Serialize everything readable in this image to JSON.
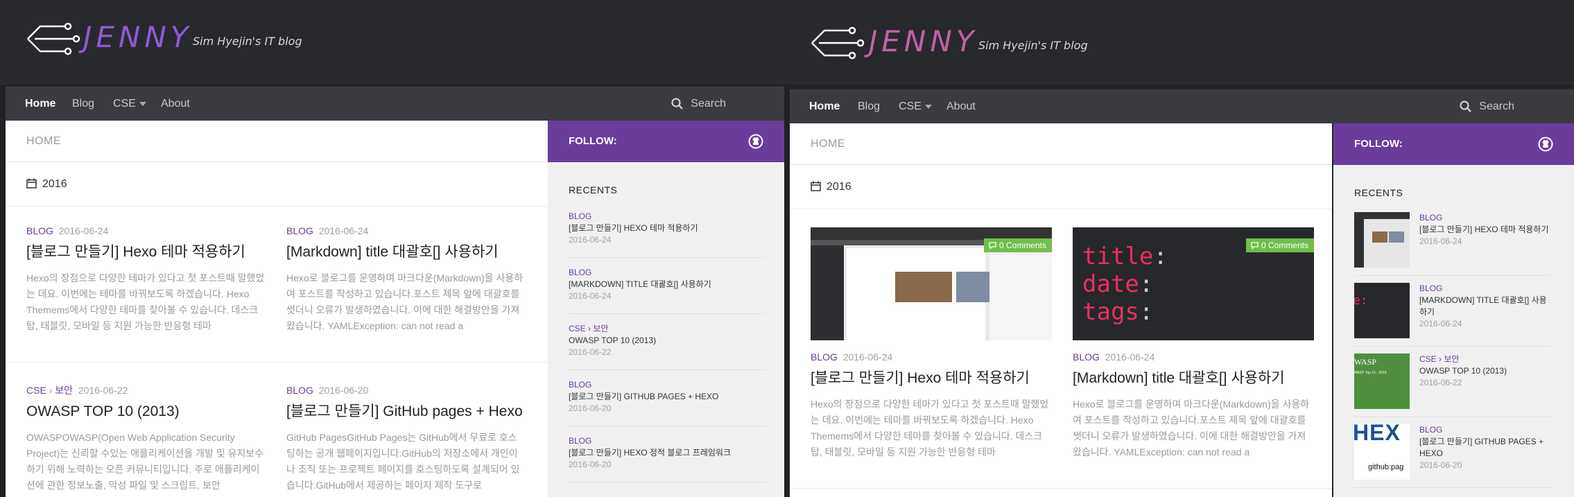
{
  "left": {
    "header": {
      "logo_text": "JENNY",
      "tagline": "Sim Hyejin's IT blog"
    },
    "nav": {
      "items": [
        "Home",
        "Blog",
        "CSE",
        "About"
      ],
      "search": "Search"
    },
    "breadcrumb": "HOME",
    "year": "2016",
    "posts": [
      {
        "category": "BLOG",
        "date": "2016-06-24",
        "title": "[블로그 만들기] Hexo 테마 적용하기",
        "excerpt": "Hexo의 장점으로 다양한 테마가 있다고 첫 포스트때 말했었는 데요. 이번에는 테마를 바꿔보도록 하겠습니다. Hexo Themems에서 다양한 테마를 찾아볼 수 있습니다. 데스크탑, 태블릿, 모바일 등 지원 가능한 반응형 테마"
      },
      {
        "category": "BLOG",
        "date": "2016-06-24",
        "title": "[Markdown] title 대괄호[] 사용하기",
        "excerpt": "Hexo로 블로그를 운영하며 마크다운(Markdown)을 사용하여 포스트를 작성하고 있습니다.포스트 제목 앞에 대괄호를 썻더니 오류가 발생하였습니다. 이에 대한 해결방안을 가져왔습니다. YAMLException: can not read a"
      },
      {
        "category": "CSE",
        "subcategory": "보안",
        "date": "2016-06-22",
        "title": "OWASP TOP 10 (2013)",
        "excerpt": "OWASPOWASP(Open Web Application Security Project)는 신뢰할 수있는 애플리케이션을 개발 및 유지보수하기 위해 노력하는 오픈 커뮤니티입니다. 주로 애플리케이션에 관한 정보노출, 악성 파일 및 스크립트, 보안"
      },
      {
        "category": "BLOG",
        "date": "2016-06-20",
        "title": "[블로그 만들기] GitHub pages + Hexo",
        "excerpt": "GitHub PagesGitHub Pages는 GitHub에서 무료로 호스팅하는 공개 웹페이지입니다.GitHub의 저장소에서 개인이나 조직 또는 프로젝트 페이지를 호스팅하도록 설계되어 있습니다.GitHub에서 제공하는 페이지 제작 도구로"
      }
    ],
    "sidebar": {
      "follow": "FOLLOW:",
      "recents_title": "RECENTS",
      "items": [
        {
          "category": "BLOG",
          "title": "[블로그 만들기] HEXO 테마 적용하기",
          "date": "2016-06-24"
        },
        {
          "category": "BLOG",
          "title": "[MARKDOWN] TITLE 대괄호[] 사용하기",
          "date": "2016-06-24"
        },
        {
          "category": "CSE › 보안",
          "title": "OWASP TOP 10 (2013)",
          "date": "2016-06-22"
        },
        {
          "category": "BLOG",
          "title": "[블로그 만들기] GITHUB PAGES + HEXO",
          "date": "2016-06-20"
        },
        {
          "category": "BLOG",
          "title": "[블로그 만들기] HEXO 정적 블로그 프레임워크",
          "date": "2016-06-20"
        }
      ]
    }
  },
  "right": {
    "header": {
      "logo_text": "JENNY",
      "tagline": "Sim Hyejin's IT blog"
    },
    "nav": {
      "items": [
        "Home",
        "Blog",
        "CSE",
        "About"
      ],
      "search": "Search"
    },
    "breadcrumb": "HOME",
    "year": "2016",
    "posts": [
      {
        "category": "BLOG",
        "date": "2016-06-24",
        "title": "[블로그 만들기] Hexo 테마 적용하기",
        "comments": "0 Comments",
        "excerpt": "Hexo의 장점으로 다양한 테마가 있다고 첫 포스트때 말했었는 데요. 이번에는 테마를 바꿔보도록 하겠습니다. Hexo Themems에서 다양한 테마를 찾아볼 수 있습니다. 데스크탑, 태블릿, 모바일 등 지원 가능한 반응형 테마"
      },
      {
        "category": "BLOG",
        "date": "2016-06-24",
        "title": "[Markdown] title 대괄호[] 사용하기",
        "comments": "0 Comments",
        "excerpt": "Hexo로 블로그를 운영하며 마크다운(Markdown)을 사용하여 포스트를 작성하고 있습니다.포스트 제목 앞에 대괄호를 썻더니 오류가 발생하였습니다. 이에 대한 해결방안을 가져왔습니다. YAMLException: can not read a"
      }
    ],
    "code_thumb": [
      "title",
      "date",
      "tags"
    ],
    "sidebar": {
      "follow": "FOLLOW:",
      "recents_title": "RECENTS",
      "items": [
        {
          "category": "BLOG",
          "title": "[블로그 만들기] HEXO 테마 적용하기",
          "date": "2016-06-24"
        },
        {
          "category": "BLOG",
          "title": "[MARKDOWN] TITLE 대괄호[] 사용하기",
          "date": "2016-06-24"
        },
        {
          "category": "CSE › 보안",
          "title": "OWASP TOP 10 (2013)",
          "date": "2016-06-22"
        },
        {
          "category": "BLOG",
          "title": "[블로그 만들기] GITHUB PAGES + HEXO",
          "date": "2016-06-20"
        }
      ],
      "thumb_labels": {
        "owasp": "WASP",
        "owasp_sub": "WASP Top 10 - 2013",
        "hexo": "HEX",
        "github": "github:pag"
      }
    }
  },
  "colors": {
    "accent": "#6a3d9a",
    "header_bg": "#28292c",
    "nav_bg": "#393b40",
    "badge": "#6fbf4a"
  }
}
